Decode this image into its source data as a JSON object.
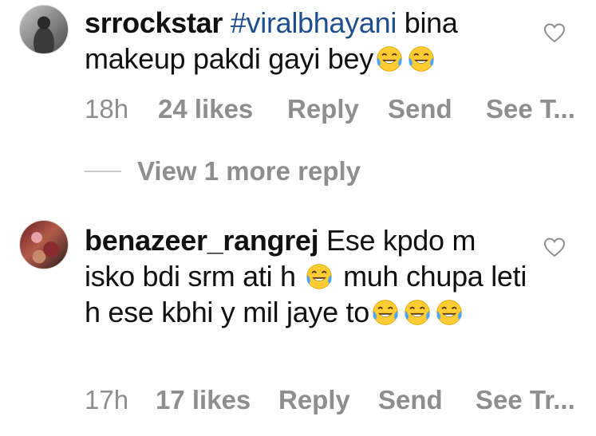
{
  "comments": [
    {
      "username": "srrockstar",
      "hashtag": "#viralbhayani",
      "text_before_emoji": "bina makeup pakdi gayi bey",
      "emoji_count_end": 2,
      "time": "18h",
      "likes": "24 likes",
      "reply": "Reply",
      "send": "Send",
      "see_translation": "See T..."
    },
    {
      "username": "benazeer_rangrej",
      "text_part1": "Ese kpdo m isko bdi srm ati h",
      "text_part2": "muh chupa leti h ese kbhi y mil jaye to",
      "emoji_count_end": 3,
      "time": "17h",
      "likes": "17 likes",
      "reply": "Reply",
      "send": "Send",
      "see_translation": "See Tr..."
    }
  ],
  "view_more": {
    "label": "View 1 more reply"
  },
  "icons": {
    "heart": "heart-outline-icon",
    "emoji": "face-with-tears-of-joy-emoji",
    "avatar_1": "profile-photo-srrockstar",
    "avatar_2": "profile-photo-benazeer"
  },
  "colors": {
    "text_primary": "#111111",
    "text_secondary": "#8e8e8e",
    "hashtag": "#1f4e8c",
    "divider": "#c7c7c7"
  }
}
